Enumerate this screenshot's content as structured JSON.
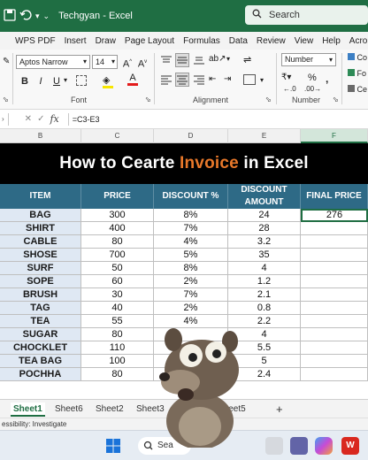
{
  "titlebar": {
    "save_icon": "save-icon",
    "title": "Techgyan  -  Excel",
    "search_placeholder": "Search"
  },
  "menu": [
    "WPS PDF",
    "Insert",
    "Draw",
    "Page Layout",
    "Formulas",
    "Data",
    "Review",
    "View",
    "Help",
    "Acroba"
  ],
  "ribbon": {
    "font_name": "Aptos Narrow",
    "font_size": "14",
    "font_group_label": "Font",
    "alignment_group_label": "Alignment",
    "number_group_label": "Number",
    "number_format": "Number",
    "side_labels": [
      "Co",
      "Fo",
      "Ce"
    ]
  },
  "formula_bar": {
    "formula": "=C3-E3"
  },
  "columns": [
    {
      "label": "B"
    },
    {
      "label": "C"
    },
    {
      "label": "D"
    },
    {
      "label": "E"
    },
    {
      "label": "F"
    }
  ],
  "banner": {
    "part1": "How to Cearte ",
    "accent": "Invoice",
    "part2": " in Excel"
  },
  "table": {
    "headers": [
      "ITEM",
      "PRICE",
      "DISCOUNT %",
      "DISCOUNT AMOUNT",
      "FINAL PRICE"
    ],
    "rows": [
      [
        "BAG",
        "300",
        "8%",
        "24",
        "276"
      ],
      [
        "SHIRT",
        "400",
        "7%",
        "28",
        ""
      ],
      [
        "CABLE",
        "80",
        "4%",
        "3.2",
        ""
      ],
      [
        "SHOSE",
        "700",
        "5%",
        "35",
        ""
      ],
      [
        "SURF",
        "50",
        "8%",
        "4",
        ""
      ],
      [
        "SOPE",
        "60",
        "2%",
        "1.2",
        ""
      ],
      [
        "BRUSH",
        "30",
        "7%",
        "2.1",
        ""
      ],
      [
        "TAG",
        "40",
        "2%",
        "0.8",
        ""
      ],
      [
        "TEA",
        "55",
        "4%",
        "2.2",
        ""
      ],
      [
        "SUGAR",
        "80",
        "",
        "4",
        ""
      ],
      [
        "CHOCKLET",
        "110",
        "",
        "5.5",
        ""
      ],
      [
        "TEA BAG",
        "100",
        "",
        "5",
        ""
      ],
      [
        "POCHHA",
        "80",
        "",
        "2.4",
        ""
      ]
    ]
  },
  "sheet_tabs": [
    "Sheet1",
    "Sheet6",
    "Sheet2",
    "Sheet3",
    "Sheet5"
  ],
  "add_sheet": "+",
  "status": "essibility: Investigate",
  "taskbar": {
    "search_label": "Sea"
  },
  "colors": {
    "excel_green": "#1f6e43",
    "header_blue": "#2e6a86",
    "item_fill": "#dfe8f3",
    "accent_orange": "#e8782a"
  }
}
